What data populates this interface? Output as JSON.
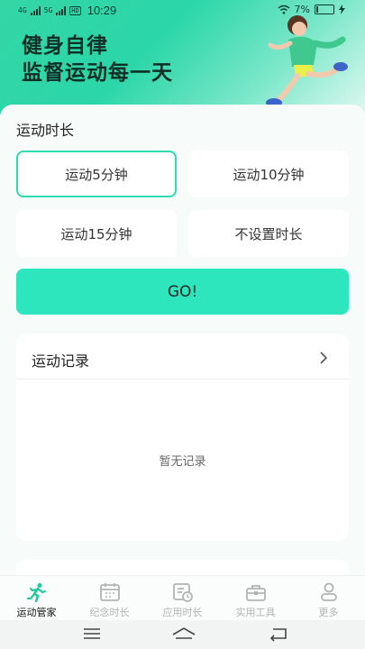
{
  "status": {
    "net1": "4G",
    "net2": "5G",
    "hd": "HD",
    "time": "10:29",
    "battery": "7%"
  },
  "hero": {
    "line1": "健身自律",
    "line2": "监督运动每一天"
  },
  "duration": {
    "label": "运动时长",
    "options": [
      {
        "label": "运动5分钟",
        "selected": true
      },
      {
        "label": "运动10分钟",
        "selected": false
      },
      {
        "label": "运动15分钟",
        "selected": false
      },
      {
        "label": "不设置时长",
        "selected": false
      }
    ],
    "go_label": "GO!"
  },
  "records": {
    "title": "运动记录",
    "empty_text": "暂无记录"
  },
  "tabs": [
    {
      "label": "运动管家",
      "icon": "runner-icon",
      "active": true
    },
    {
      "label": "纪念时长",
      "icon": "calendar-icon",
      "active": false
    },
    {
      "label": "应用时长",
      "icon": "app-clock-icon",
      "active": false
    },
    {
      "label": "实用工具",
      "icon": "toolbox-icon",
      "active": false
    },
    {
      "label": "更多",
      "icon": "person-icon",
      "active": false
    }
  ],
  "colors": {
    "accent": "#2ee6bd",
    "hero_green": "#34d6a6",
    "active_tab_icon": "#22c9a0",
    "inactive": "#b0b4b3"
  }
}
